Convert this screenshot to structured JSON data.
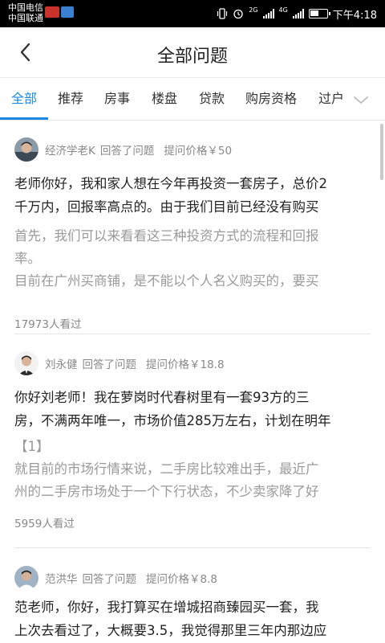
{
  "status_bar": {
    "carrier_1": "中国电信",
    "carrier_2": "中国联通",
    "network_1": "2G",
    "network_2": "4G",
    "time": "下午4:18"
  },
  "header": {
    "title": "全部问题"
  },
  "tabs": [
    {
      "label": "全部",
      "active": true
    },
    {
      "label": "推荐",
      "active": false
    },
    {
      "label": "房事",
      "active": false
    },
    {
      "label": "楼盘",
      "active": false
    },
    {
      "label": "贷款",
      "active": false
    },
    {
      "label": "购房资格",
      "active": false
    },
    {
      "label": "过户",
      "active": false
    }
  ],
  "questions": [
    {
      "expert": "经济学老K",
      "action": "回答了问题",
      "price": "提问价格￥50",
      "question_line_1": "老师你好，我和家人想在今年再投资一套房子，总价2",
      "question_line_2": "千万内，回报率高点的。由于我们目前已经没有购买",
      "answer_line_1": "首先，我们可以来看看这三种投资方式的流程和回报",
      "answer_line_2": "率。",
      "answer_line_3": "目前在广州买商铺，是不能以个人名义购买的，要买",
      "views": "17973人看过"
    },
    {
      "expert": "刘永健",
      "action": "回答了问题",
      "price": "提问价格￥18.8",
      "question_line_1": "你好刘老师！我在萝岗时代春树里有一套93方的三",
      "question_line_2": "房，不满两年唯一，市场价值285万左右，计划在明年",
      "answer_line_1": "【1】",
      "answer_line_2": "就目前的市场行情来说，二手房比较难出手，最近广",
      "answer_line_3": "州的二手房市场处于一个下行状态，不少卖家降了好",
      "views": "5959人看过"
    },
    {
      "expert": "范洪华",
      "action": "回答了问题",
      "price": "提问价格￥8.8",
      "question_line_1": "范老师，你好，我打算买在增城招商臻园买一套，我",
      "question_line_2": "上次去看过了，大概要3.5，我觉得那里三年内那边应"
    }
  ],
  "colors": {
    "accent": "#1a8ae5",
    "muted_text": "#9a9a9a",
    "divider": "#e5e5e5"
  }
}
